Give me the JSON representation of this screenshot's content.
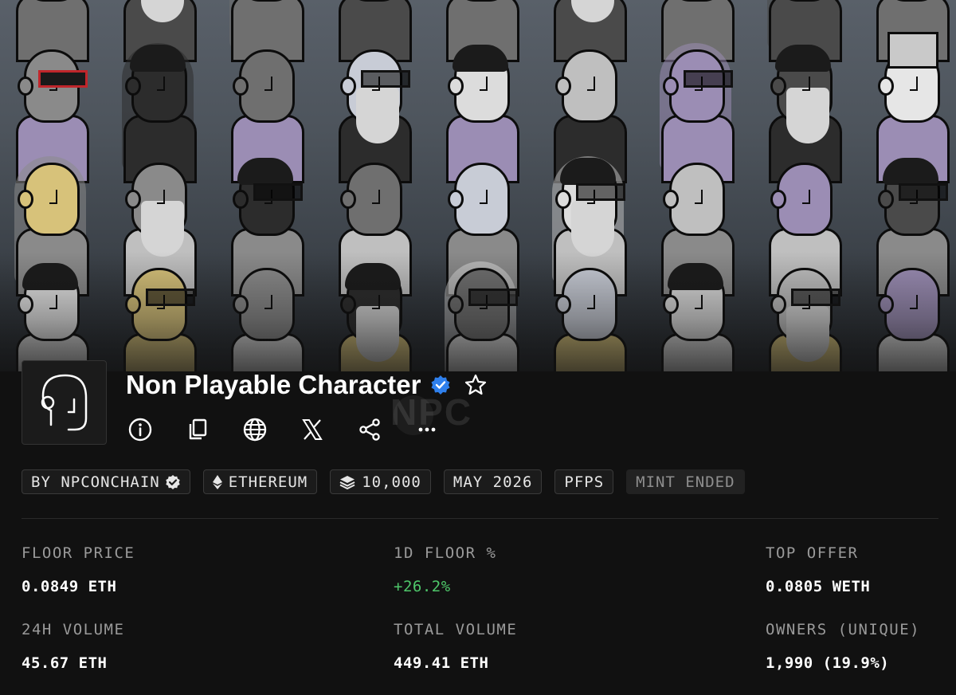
{
  "collection": {
    "name": "Non Playable Character",
    "verified": true,
    "banner_label": "NPC character grid banner",
    "watermark": "NPC"
  },
  "actions": [
    {
      "name": "info-icon"
    },
    {
      "name": "copy-icon"
    },
    {
      "name": "globe-icon"
    },
    {
      "name": "x-icon"
    },
    {
      "name": "share-icon"
    },
    {
      "name": "more-icon"
    }
  ],
  "tags": {
    "creator": "BY NPCONCHAIN",
    "chain": "ETHEREUM",
    "supply": "10,000",
    "date": "MAY 2026",
    "category": "PFPS",
    "status": "MINT ENDED"
  },
  "stats": {
    "floor_price": {
      "label": "FLOOR PRICE",
      "value": "0.0849 ETH"
    },
    "floor_change": {
      "label": "1D FLOOR %",
      "value": "+26.2%"
    },
    "top_offer": {
      "label": "TOP OFFER",
      "value": "0.0805 WETH"
    },
    "volume_24h": {
      "label": "24H VOLUME",
      "value": "45.67 ETH"
    },
    "total_volume": {
      "label": "TOTAL VOLUME",
      "value": "449.41 ETH"
    },
    "owners": {
      "label": "OWNERS (UNIQUE)",
      "value": "1,990 (19.9%)"
    }
  },
  "colors": {
    "background": "#111111",
    "positive": "#4ec76a",
    "verified": "#2f80ed",
    "label": "#9a9a9a"
  }
}
